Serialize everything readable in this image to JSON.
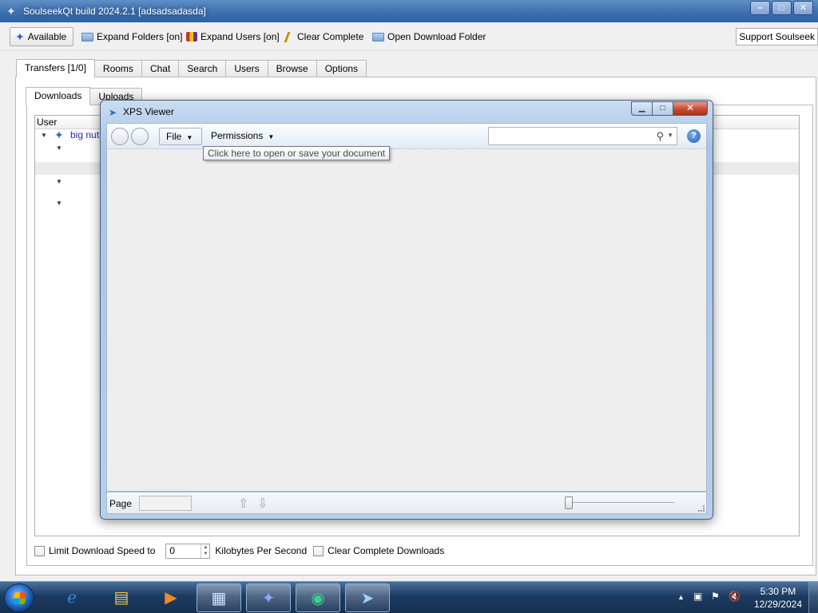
{
  "main": {
    "title": "SoulseekQt build 2024.2.1 [adsadsadasda]",
    "toolbar": {
      "available": "Available",
      "expand_folders": "Expand Folders [on]",
      "expand_users": "Expand Users [on]",
      "clear_complete": "Clear Complete",
      "open_download_folder": "Open Download Folder",
      "support": "Support Soulseek"
    },
    "tabs": [
      "Transfers [1/0]",
      "Rooms",
      "Chat",
      "Search",
      "Users",
      "Browse",
      "Options"
    ],
    "sub_tabs": [
      "Downloads",
      "Uploads"
    ],
    "tree": {
      "column_user": "User",
      "peer": "big nuts"
    },
    "bottom": {
      "limit_label": "Limit Download Speed to",
      "limit_value": "0",
      "kbps_label": "Kilobytes Per Second",
      "clear_complete_label": "Clear Complete Downloads"
    }
  },
  "xps": {
    "title": "XPS Viewer",
    "file_menu": "File",
    "permissions_menu": "Permissions",
    "tooltip": "Click here to open or save your document",
    "search_placeholder": "",
    "page_label": "Page",
    "page_value": ""
  },
  "taskbar": {
    "clock_time": "5:30 PM",
    "clock_date": "12/29/2024"
  },
  "colors": {
    "titlebar": "#3d70ad",
    "taskbar": "#1c3b62",
    "close_button": "#c54b35",
    "peer_link": "#2a2aa8"
  },
  "icons": [
    "soulseek-bird-icon",
    "folder-icon",
    "users-icon",
    "broom-icon",
    "search-icon",
    "help-icon",
    "windows-start-icon",
    "internet-explorer-icon",
    "explorer-folder-icon",
    "media-player-icon"
  ]
}
